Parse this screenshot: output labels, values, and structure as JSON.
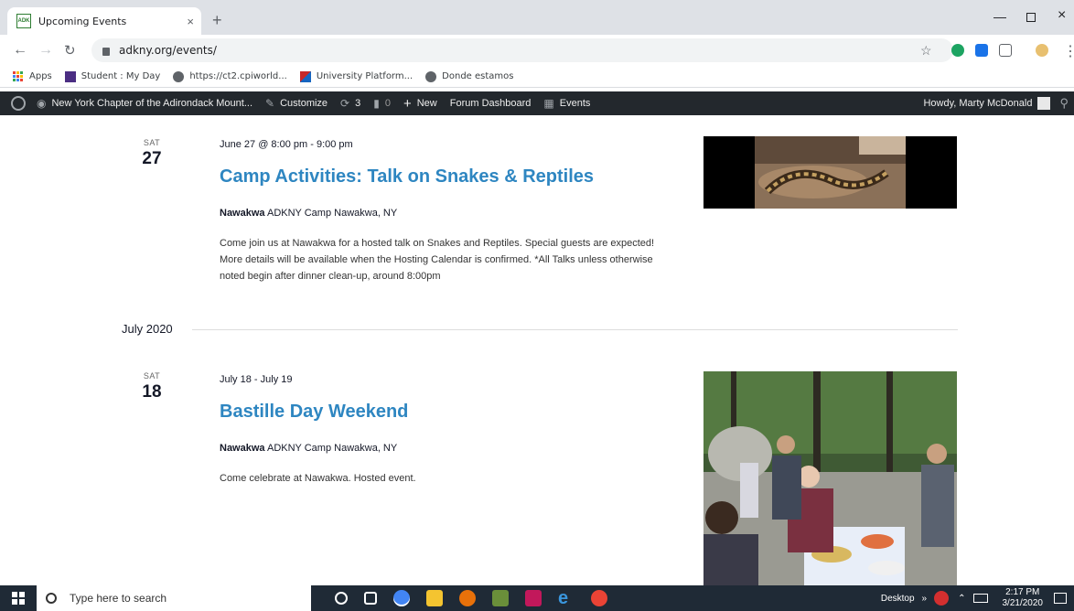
{
  "browser": {
    "tab_title": "Upcoming Events",
    "tab_favicon_text": "ADK",
    "close_glyph": "×",
    "newtab_glyph": "+",
    "url": "adkny.org/events/",
    "bookmarks": [
      {
        "label": "Apps",
        "icon": "apps-grid-icon"
      },
      {
        "label": "Student : My Day",
        "icon": "student-icon"
      },
      {
        "label": "https://ct2.cpiworld...",
        "icon": "globe-icon"
      },
      {
        "label": "University Platform...",
        "icon": "university-icon"
      },
      {
        "label": "Donde estamos",
        "icon": "globe-icon"
      }
    ]
  },
  "adminbar": {
    "site": "New York Chapter of the Adirondack Mount...",
    "customize": "Customize",
    "updates": "3",
    "comments": "0",
    "new": "New",
    "forum": "Forum Dashboard",
    "events": "Events",
    "howdy": "Howdy, Marty McDonald"
  },
  "events": [
    {
      "dow": "SAT",
      "day": "27",
      "time": "June 27 @ 8:00 pm - 9:00 pm",
      "title": "Camp Activities: Talk on Snakes & Reptiles",
      "venue_name": "Nawakwa",
      "venue_rest": " ADKNY Camp Nawakwa, NY",
      "description": "Come join us at Nawakwa for a hosted talk on Snakes and Reptiles. Special guests are expected! More details will be available when the Hosting Calendar is confirmed. *All Talks unless otherwise noted begin after dinner clean-up, around 8:00pm"
    },
    {
      "dow": "SAT",
      "day": "18",
      "time": "July 18 - July 19",
      "title": "Bastille Day Weekend",
      "venue_name": "Nawakwa",
      "venue_rest": " ADKNY Camp Nawakwa, NY",
      "description": "Come celebrate at Nawakwa. Hosted event."
    }
  ],
  "month_separator": "July 2020",
  "taskbar": {
    "search_placeholder": "Type here to search",
    "desktop_label": "Desktop",
    "time": "2:17 PM",
    "date": "3/21/2020"
  }
}
